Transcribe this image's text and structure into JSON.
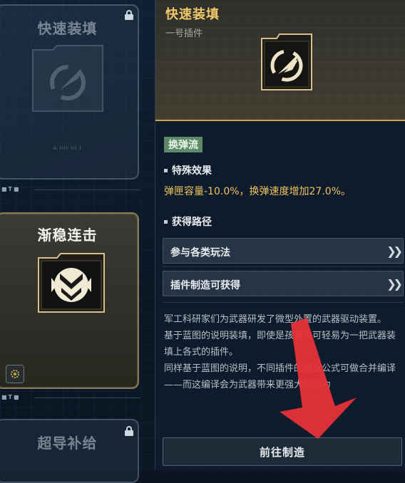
{
  "left_cards": [
    {
      "title": "快速装填",
      "locked": true,
      "caption": "A IIII III I"
    },
    {
      "title": "渐稳连击",
      "locked": false,
      "caption": ""
    },
    {
      "title": "超导补给",
      "locked": true,
      "caption": ""
    }
  ],
  "section_markers": [
    "■T■",
    "■T■",
    "■T■"
  ],
  "detail": {
    "name": "快速装填",
    "type": "一号插件",
    "icon": "reload-rocket-icon",
    "tag": "换弹流",
    "effect_heading": "特殊效果",
    "effect_text": "弹匣容量-10.0%，换弹速度增加27.0%。",
    "route_heading": "获得路径",
    "routes": [
      {
        "label": "参与各类玩法",
        "icon": "double-chevron-right-icon"
      },
      {
        "label": "插件制造可获得",
        "icon": "double-chevron-right-icon"
      }
    ],
    "description": [
      "军工科研家们为武器研发了微型外置的武器驱动装置。",
      "基于蓝图的说明装填，即使是孩童也可轻易为一把武器装填上各式的插件。",
      "同样基于蓝图的说明，不同插件的组合公式可做合并编译——而这编译会为武器带来更强大的能力"
    ],
    "craft_button": "前往制造"
  },
  "colors": {
    "accent_gold": "#f1c86a",
    "effect_text": "#efc25e",
    "tag_green": "#5d8a68",
    "overlay_arrow": "#e8323a"
  }
}
